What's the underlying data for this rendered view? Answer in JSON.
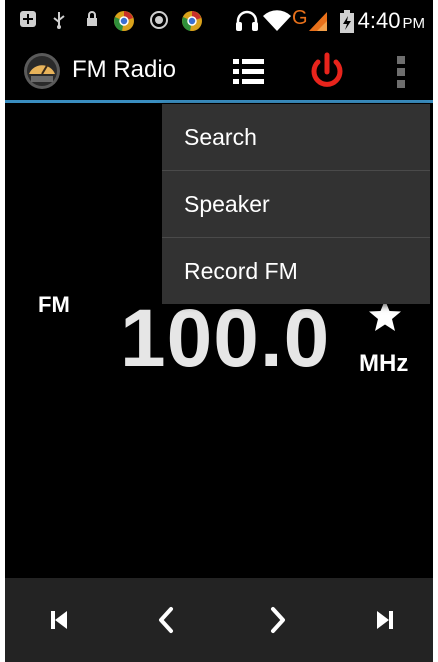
{
  "status_bar": {
    "time": "4:40",
    "ampm": "PM",
    "icons": [
      "plus-box-icon",
      "usb-icon",
      "lock-icon",
      "chrome-icon",
      "compass-icon",
      "chrome-icon",
      "headset-icon",
      "wifi-icon",
      "network-g-icon",
      "signal-icon",
      "battery-charging-icon"
    ],
    "network_label": "G"
  },
  "app_bar": {
    "title": "FM Radio",
    "logo_icon": "radio-dial-icon",
    "actions": [
      "channel-list-icon",
      "power-icon",
      "overflow-menu-icon"
    ],
    "accent_color": "#3a8ec0",
    "power_color": "#e8241c"
  },
  "tuner": {
    "band": "FM",
    "frequency": "100.0",
    "unit": "MHz",
    "favorite_icon": "star-icon"
  },
  "menu": {
    "items": [
      {
        "label": "Search"
      },
      {
        "label": "Speaker"
      },
      {
        "label": "Record FM"
      }
    ]
  },
  "controls": {
    "items": [
      "skip-previous-icon",
      "seek-previous-icon",
      "seek-next-icon",
      "skip-next-icon"
    ]
  }
}
